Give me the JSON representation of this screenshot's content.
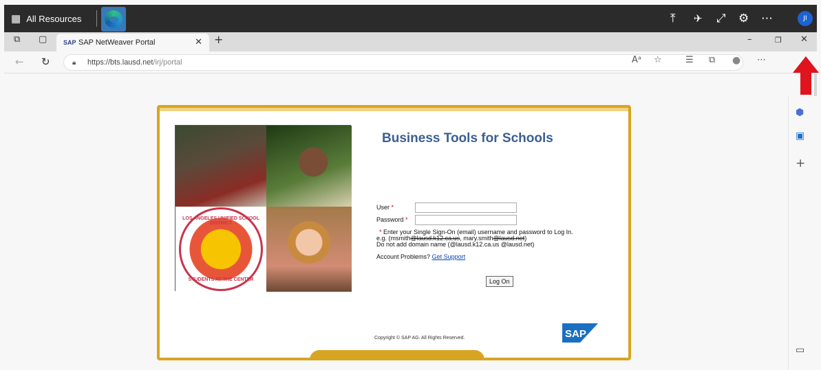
{
  "taskbar": {
    "all_resources_label": "All Resources",
    "avatar_initials": "JI"
  },
  "tab": {
    "title": "SAP NetWeaver Portal",
    "favicon_text": "SAP"
  },
  "address_bar": {
    "url_host": "https://bts.lausd.net",
    "url_path": "/irj/portal"
  },
  "portal": {
    "title": "Business Tools for Schools",
    "user_label": "User",
    "password_label": "Password",
    "required_mark": "*",
    "user_value": "",
    "password_value": "",
    "help_line1": " Enter your Single Sign-On (email) username and password to Log In.",
    "help_line2_prefix": "e.g. (msmith",
    "help_line2_strike1": "@lausd.k12.ca.us",
    "help_line2_mid": ", mary.smith",
    "help_line2_strike2": "@lausd.net",
    "help_line2_suffix": ")",
    "help_line3": "Do not add domain name (@lausd.k12.ca.us @lausd.net)",
    "account_problems_label": "Account Problems?",
    "get_support_link": "Get Support",
    "logon_button": "Log On",
    "copyright": "Copyright © SAP AG. All Rights Reserved.",
    "sap_logo_text": "SAP",
    "seal_top": "LOS ANGELES UNIFIED SCHOOL DISTRICT",
    "seal_bottom": "STUDENTS AT THE CENTER"
  },
  "colors": {
    "accent": "#d8a523",
    "title_blue": "#3a5f94",
    "arrow_red": "#e0141e"
  }
}
